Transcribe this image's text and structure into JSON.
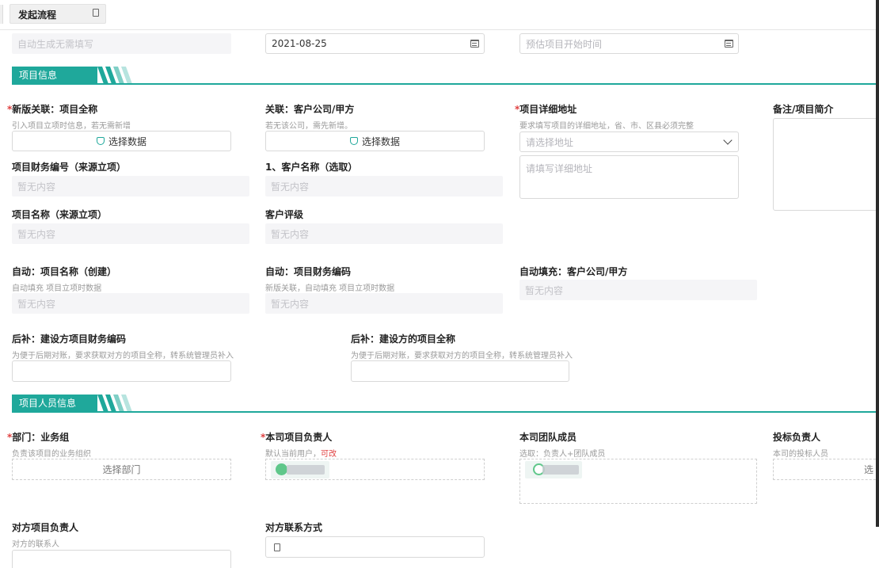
{
  "tabbar": {
    "active_tab": "发起流程"
  },
  "top_row": {
    "auto_no_placeholder": "自动生成无需填写",
    "date_value": "2021-08-25",
    "start_time_placeholder": "预估项目开始时间"
  },
  "section_project": {
    "title": "项目信息"
  },
  "fields": {
    "project_fullname": {
      "required": "*",
      "label": "新版关联：项目全称",
      "hint": "引入项目立项时信息，若无需新增",
      "button": "选择数据"
    },
    "client_company": {
      "label": "关联：客户公司/甲方",
      "hint": "若无该公司，需先新增。",
      "button": "选择数据"
    },
    "address": {
      "required": "*",
      "label": "项目详细地址",
      "hint": "要求填写项目的详细地址，省、市、区县必须完整",
      "select_placeholder": "请选择地址",
      "detail_placeholder": "请填写详细地址"
    },
    "remark": {
      "label": "备注/项目简介"
    },
    "finance_no": {
      "label": "项目财务编号（来源立项）",
      "value": "暂无内容"
    },
    "client_name": {
      "label": "1、客户名称（选取）",
      "value": "暂无内容"
    },
    "project_name": {
      "label": "项目名称（来源立项）",
      "value": "暂无内容"
    },
    "client_rating": {
      "label": "客户评级",
      "value": "暂无内容"
    },
    "auto_project_name": {
      "label": "自动：项目名称（创建）",
      "hint": "自动填充 项目立项时数据",
      "value": "暂无内容"
    },
    "auto_finance_code": {
      "label": "自动：项目财务编码",
      "hint": "新版关联，自动填充 项目立项时数据",
      "value": "暂无内容"
    },
    "auto_client_company": {
      "label": "自动填充：客户公司/甲方",
      "value": "暂无内容"
    },
    "builder_finance_code": {
      "label": "后补：建设方项目财务编码",
      "hint": "为便于后期对账，要求获取对方的项目全称，转系统管理员补入"
    },
    "builder_project_name": {
      "label": "后补：建设方的项目全称",
      "hint": "为便于后期对账，要求获取对方的项目全称，转系统管理员补入"
    }
  },
  "section_people": {
    "title": "项目人员信息"
  },
  "people": {
    "department": {
      "required": "*",
      "label": "部门：业务组",
      "hint": "负责该项目的业务组织",
      "button": "选择部门"
    },
    "owner": {
      "required": "*",
      "label": "本司项目负责人",
      "hint": "默认当前用户，",
      "hint_warn": "可改"
    },
    "team": {
      "label": "本司团队成员",
      "hint": "选取：负责人+团队成员"
    },
    "bid_owner": {
      "label": "投标负责人",
      "hint": "本司的投标人员",
      "button": "选"
    },
    "counterpart_owner": {
      "label": "对方项目负责人",
      "hint": "对方的联系人"
    },
    "counterpart_contact": {
      "label": "对方联系方式"
    }
  },
  "colors": {
    "accent": "#1fa89b",
    "required": "#e04040"
  },
  "icons": {
    "calendar": "calendar-icon",
    "database": "database-icon",
    "chevron": "chevron-down-icon",
    "phone": "phone-icon",
    "close": "close-icon"
  }
}
